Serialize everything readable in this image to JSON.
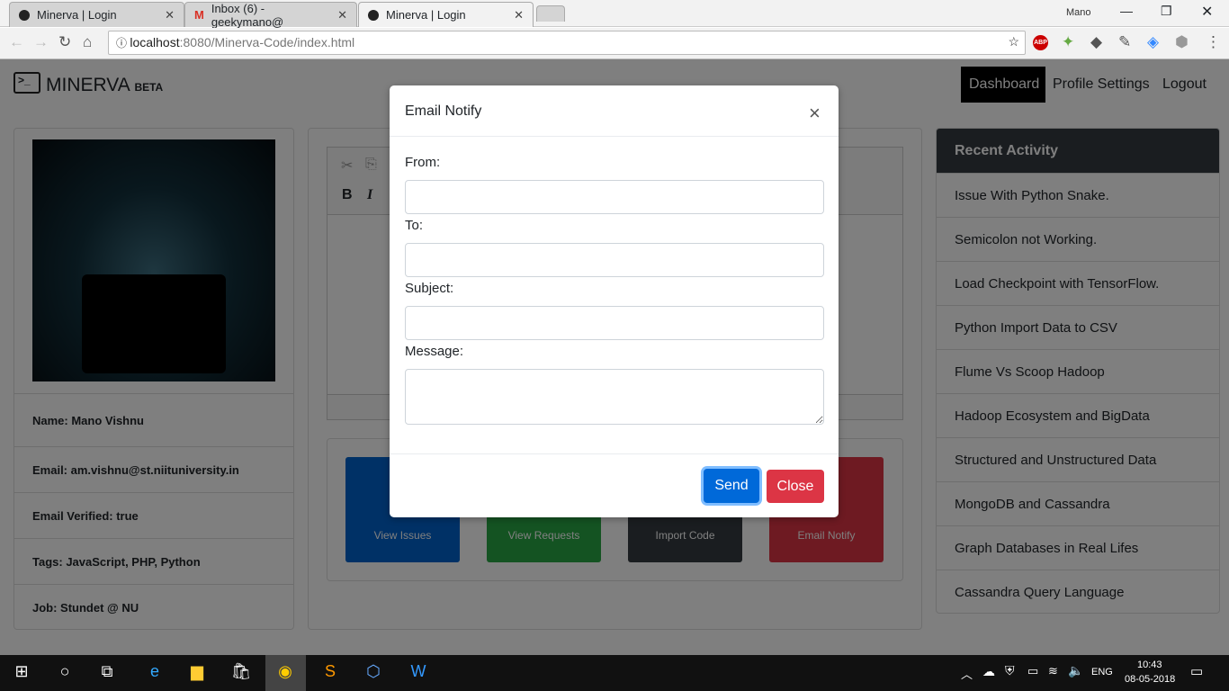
{
  "browser": {
    "tabs": [
      {
        "title": "Minerva | Login",
        "active": false
      },
      {
        "title": "Inbox (6) - geekymano@",
        "active": false
      },
      {
        "title": "Minerva | Login",
        "active": true
      }
    ],
    "profile_name": "Mano",
    "url_host": "localhost",
    "url_rest": ":8080/Minerva-Code/index.html"
  },
  "navbar": {
    "brand": "MINERVA",
    "brand_badge": "BETA",
    "links": [
      {
        "label": "Dashboard",
        "active": true
      },
      {
        "label": "Profile Settings"
      },
      {
        "label": "Logout"
      }
    ]
  },
  "profile": {
    "rows": [
      "Name: Mano Vishnu",
      "Email: am.vishnu@st.niituniversity.in",
      "Email Verified: true",
      "Tags: JavaScript, PHP, Python",
      "Job: Stundet @ NU"
    ]
  },
  "editor": {
    "bold": "B",
    "italic": "I"
  },
  "tiles": [
    {
      "label": "View Issues",
      "color": "#0062cc"
    },
    {
      "label": "View Requests",
      "color": "#28a745"
    },
    {
      "label": "Import Code",
      "color": "#343a40"
    },
    {
      "label": "Email Notify",
      "color": "#dc3545"
    }
  ],
  "recent": {
    "title": "Recent Activity",
    "items": [
      "Issue With Python Snake.",
      "Semicolon not Working.",
      "Load Checkpoint with TensorFlow.",
      "Python Import Data to CSV",
      "Flume Vs Scoop Hadoop",
      "Hadoop Ecosystem and BigData",
      "Structured and Unstructured Data",
      "MongoDB and Cassandra",
      "Graph Databases in Real Lifes",
      "Cassandra Query Language"
    ]
  },
  "modal": {
    "title": "Email Notify",
    "close_glyph": "×",
    "from_label": "From:",
    "to_label": "To:",
    "subject_label": "Subject:",
    "message_label": "Message:",
    "from_value": "",
    "to_value": "",
    "subject_value": "",
    "message_value": "",
    "send": "Send",
    "close": "Close"
  },
  "taskbar": {
    "lang": "ENG",
    "time": "10:43",
    "date": "08-05-2018"
  }
}
